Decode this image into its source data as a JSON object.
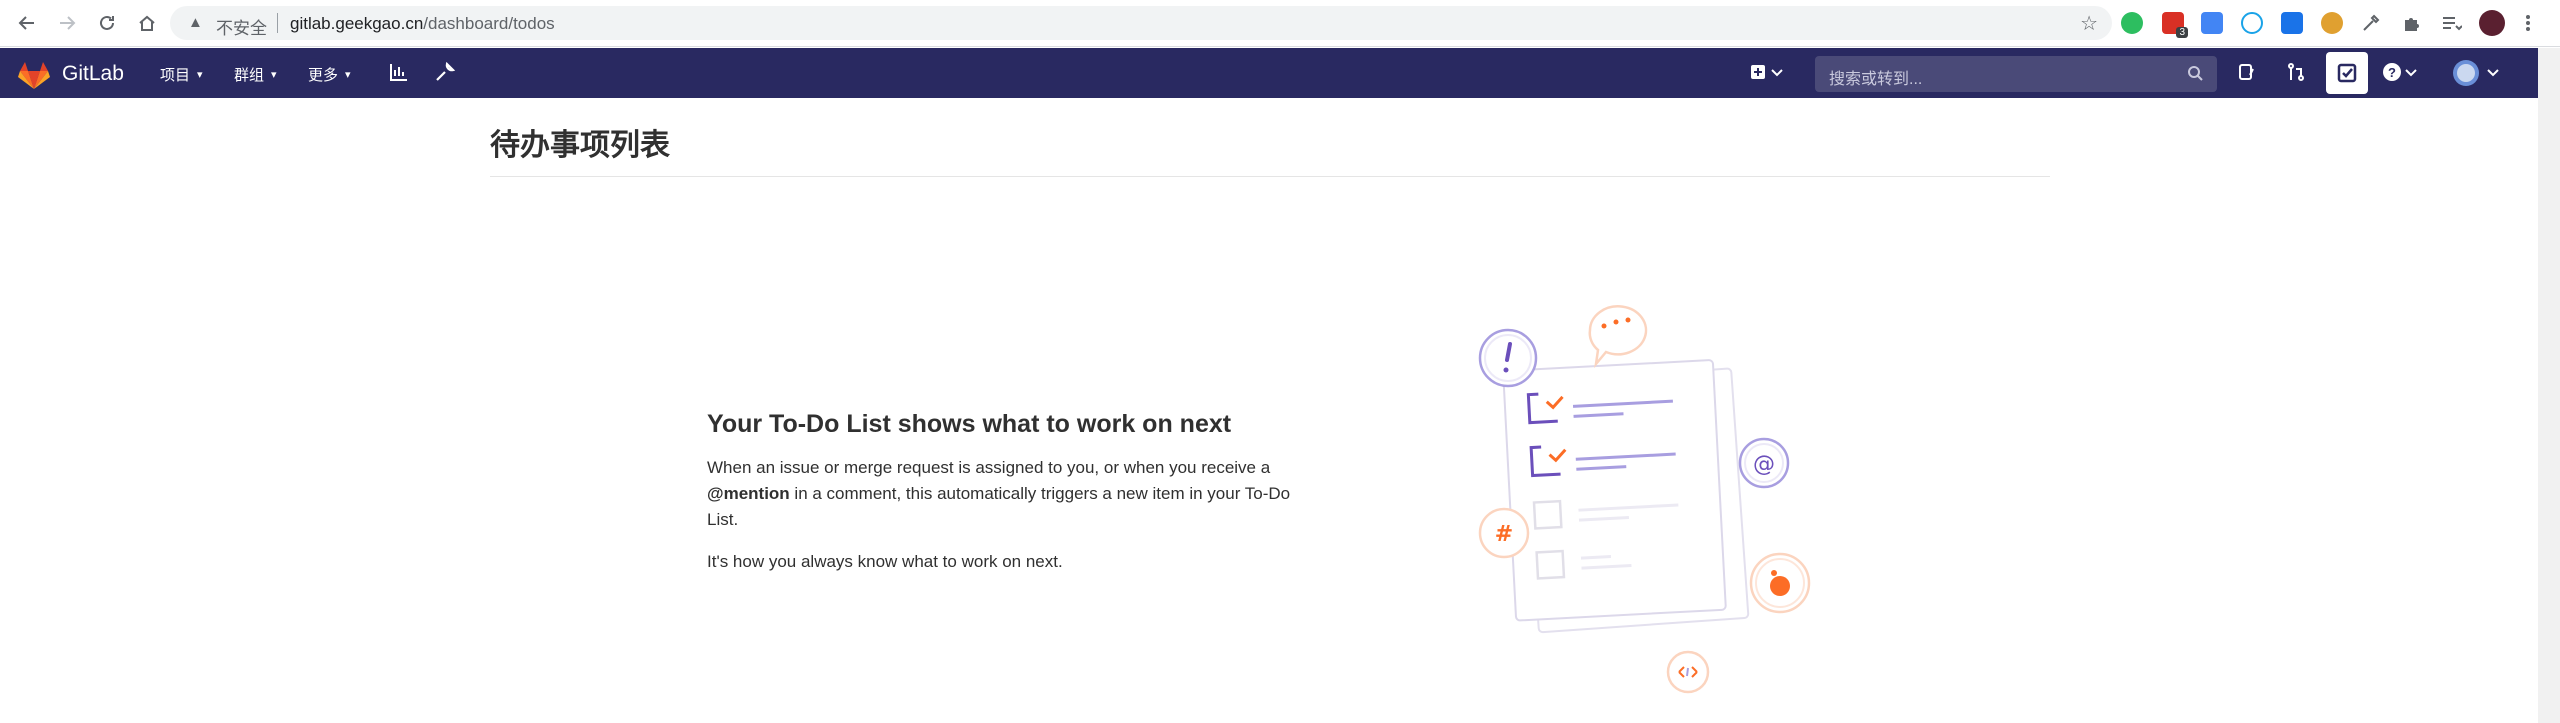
{
  "browser": {
    "insecure_label": "不安全",
    "url_host": "gitlab.geekgao.cn",
    "url_path": "/dashboard/todos",
    "extension_badge": "3"
  },
  "navbar": {
    "brand": "GitLab",
    "menu_projects": "项目",
    "menu_groups": "群组",
    "menu_more": "更多",
    "search_placeholder": "搜索或转到..."
  },
  "page": {
    "title": "待办事项列表"
  },
  "empty_state": {
    "heading": "Your To-Do List shows what to work on next",
    "text_before": "When an issue or merge request is assigned to you, or when you receive a ",
    "mention": "@mention",
    "text_after": " in a comment, this automatically triggers a new item in your To-Do List.",
    "text2": "It's how you always know what to work on next."
  }
}
